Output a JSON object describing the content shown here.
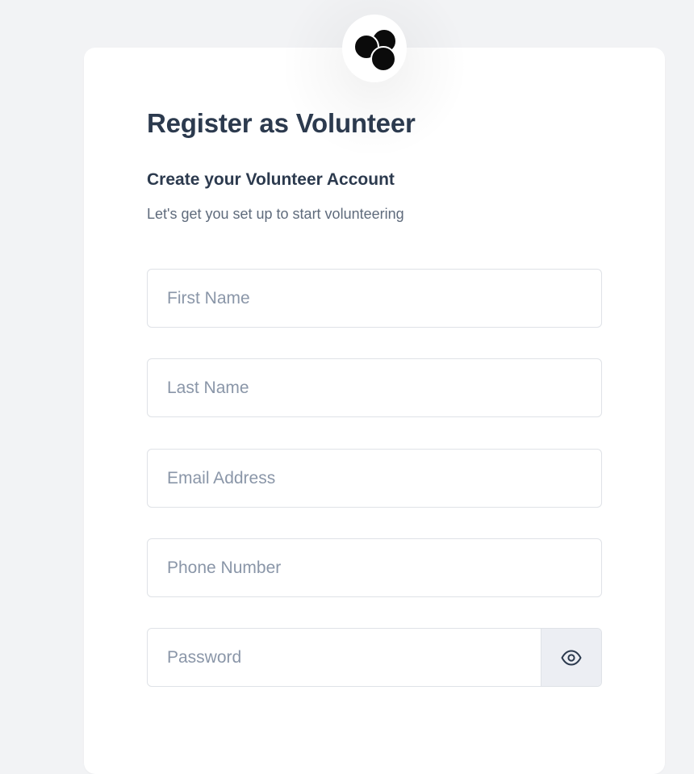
{
  "header": {
    "logo_icon": "three-circles-logo",
    "title": "Register as Volunteer",
    "subtitle": "Create your Volunteer Account",
    "tagline": "Let's get you set up to start volunteering"
  },
  "form": {
    "first_name": {
      "placeholder": "First Name",
      "value": ""
    },
    "last_name": {
      "placeholder": "Last Name",
      "value": ""
    },
    "email": {
      "placeholder": "Email Address",
      "value": ""
    },
    "phone": {
      "placeholder": "Phone Number",
      "value": ""
    },
    "password": {
      "placeholder": "Password",
      "value": "",
      "toggle_icon": "eye-icon"
    }
  },
  "colors": {
    "page_background": "#f2f3f5",
    "heading": "#2c3a4e",
    "muted_text": "#5f6b7c",
    "placeholder": "#8a96a8",
    "border": "#dfe2e7"
  }
}
